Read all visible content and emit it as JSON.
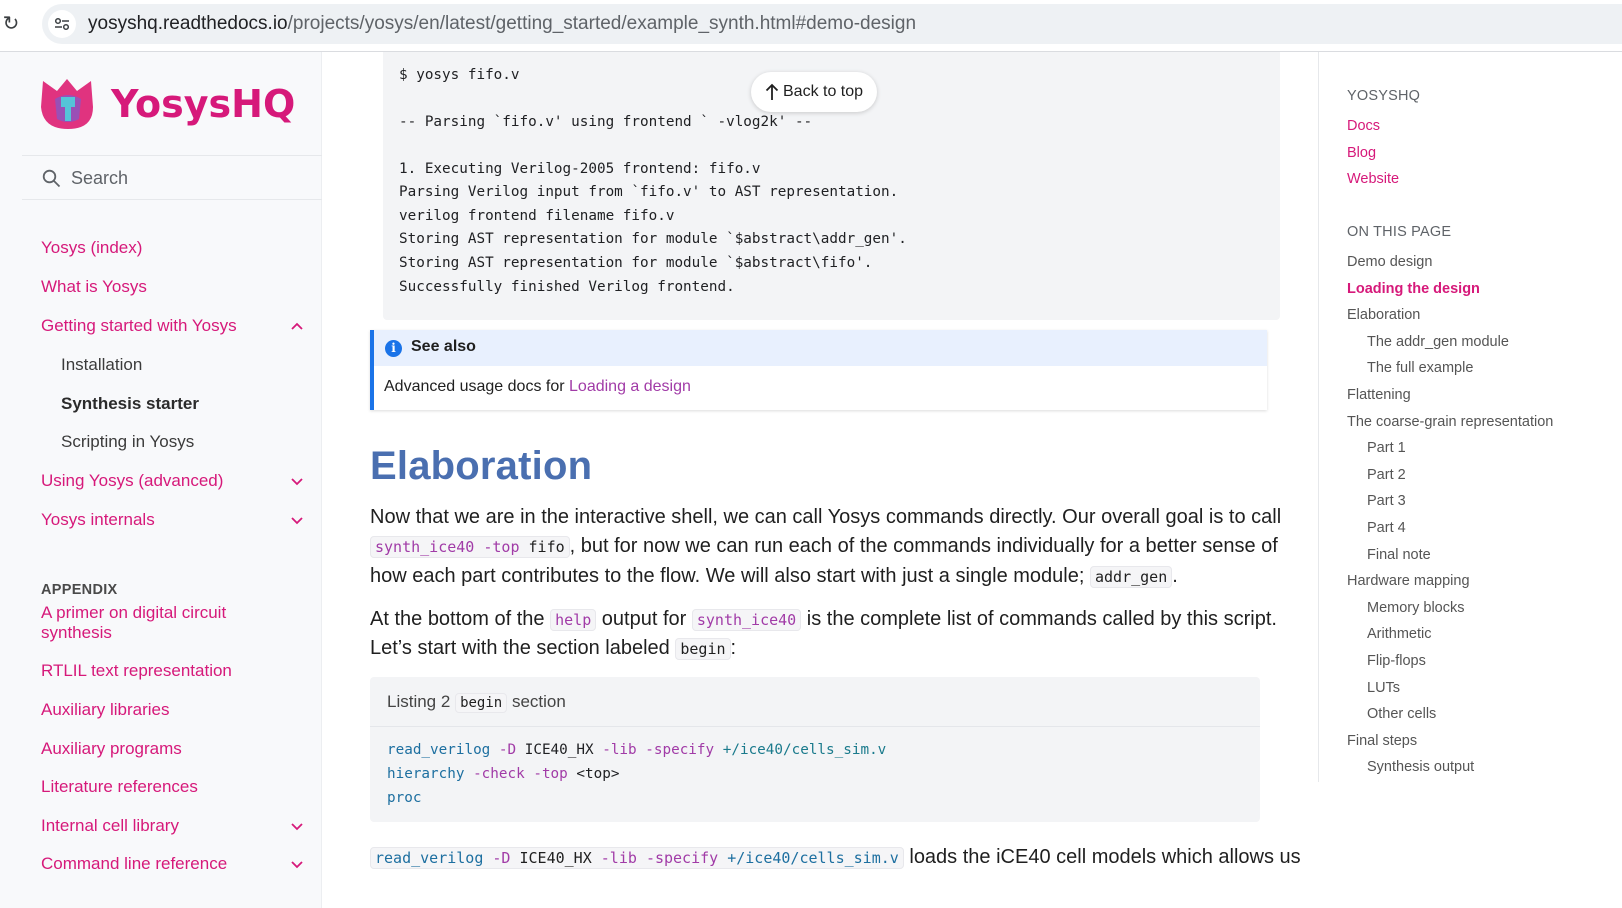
{
  "browser": {
    "url_host": "yosyshq.readthedocs.io",
    "url_path": "/projects/yosys/en/latest/getting_started/example_synth.html#demo-design"
  },
  "sidebar": {
    "logo_text": "YosysHQ",
    "search_placeholder": "Search",
    "items": [
      {
        "label": "Yosys (index)"
      },
      {
        "label": "What is Yosys"
      },
      {
        "label": "Getting started with Yosys"
      },
      {
        "label": "Installation"
      },
      {
        "label": "Synthesis starter"
      },
      {
        "label": "Scripting in Yosys"
      },
      {
        "label": "Using Yosys (advanced)"
      },
      {
        "label": "Yosys internals"
      }
    ],
    "appendix_heading": "APPENDIX",
    "appendix_items": [
      {
        "label": "A primer on digital circuit synthesis"
      },
      {
        "label": "RTLIL text representation"
      },
      {
        "label": "Auxiliary libraries"
      },
      {
        "label": "Auxiliary programs"
      },
      {
        "label": "Literature references"
      },
      {
        "label": "Internal cell library"
      },
      {
        "label": "Command line reference"
      }
    ]
  },
  "main": {
    "back_to_top": "Back to top",
    "shell_lines": [
      "$ yosys fifo.v",
      "-- Parsing `fifo.v' using frontend ` -vlog2k' --",
      "1. Executing Verilog-2005 frontend: fifo.v",
      "Parsing Verilog input from `fifo.v' to AST representation.",
      "verilog frontend filename fifo.v",
      "Storing AST representation for module `$abstract\\addr_gen'.",
      "Storing AST representation for module `$abstract\\fifo'.",
      "Successfully finished Verilog frontend."
    ],
    "see_also": {
      "title": "See also",
      "text": "Advanced usage docs for ",
      "link": "Loading a design"
    },
    "heading": "Elaboration",
    "p1": {
      "l1": "Now that we are in the interactive shell, we can call Yosys commands directly. Our overall goal is to call",
      "code_a": "synth_ice40",
      "code_b": "-top",
      "code_c": "fifo",
      "l2": ", but for now we can run each of the commands individually for a better sense of",
      "l3": "how each part contributes to the flow. We will also start with just a single module;",
      "code_d": "addr_gen",
      "l3end": "."
    },
    "p2": {
      "a": "At the bottom of the ",
      "code_help": "help",
      "b": " output for ",
      "code_synth": "synth_ice40",
      "c": " is the complete list of commands called by this script.",
      "d": "Let’s start with the section labeled ",
      "code_begin": "begin",
      "e": ":"
    },
    "listing": {
      "caption_prefix": "Listing 2",
      "caption_code": "begin",
      "caption_suffix": "section",
      "line1": {
        "cmd": "read_verilog",
        "o1": "-D",
        "a1": "ICE40_HX",
        "o2": "-lib",
        "o3": "-specify",
        "path": "+/ice40/cells_sim.v"
      },
      "line2": {
        "cmd": "hierarchy",
        "o1": "-check",
        "o2": "-top",
        "a1": "<top>"
      },
      "line3": {
        "cmd": "proc"
      }
    },
    "p3": {
      "cmd": "read_verilog",
      "o1": "-D",
      "a1": "ICE40_HX",
      "o2": "-lib",
      "o3": "-specify",
      "path": "+/ice40/cells_sim.v",
      "text": " loads the iCE40 cell models which allows us"
    }
  },
  "toc": {
    "yosyshq_heading": "YOSYSHQ",
    "links": [
      "Docs",
      "Blog",
      "Website"
    ],
    "on_this_page": "ON THIS PAGE",
    "items": [
      {
        "label": "Demo design",
        "level": 1
      },
      {
        "label": "Loading the design",
        "level": 1,
        "active": true
      },
      {
        "label": "Elaboration",
        "level": 1
      },
      {
        "label": "The addr_gen module",
        "level": 2
      },
      {
        "label": "The full example",
        "level": 2
      },
      {
        "label": "Flattening",
        "level": 1
      },
      {
        "label": "The coarse-grain representation",
        "level": 1
      },
      {
        "label": "Part 1",
        "level": 2
      },
      {
        "label": "Part 2",
        "level": 2
      },
      {
        "label": "Part 3",
        "level": 2
      },
      {
        "label": "Part 4",
        "level": 2
      },
      {
        "label": "Final note",
        "level": 2
      },
      {
        "label": "Hardware mapping",
        "level": 1
      },
      {
        "label": "Memory blocks",
        "level": 2
      },
      {
        "label": "Arithmetic",
        "level": 2
      },
      {
        "label": "Flip-flops",
        "level": 2
      },
      {
        "label": "LUTs",
        "level": 2
      },
      {
        "label": "Other cells",
        "level": 2
      },
      {
        "label": "Final steps",
        "level": 1
      },
      {
        "label": "Synthesis output",
        "level": 2
      }
    ]
  }
}
